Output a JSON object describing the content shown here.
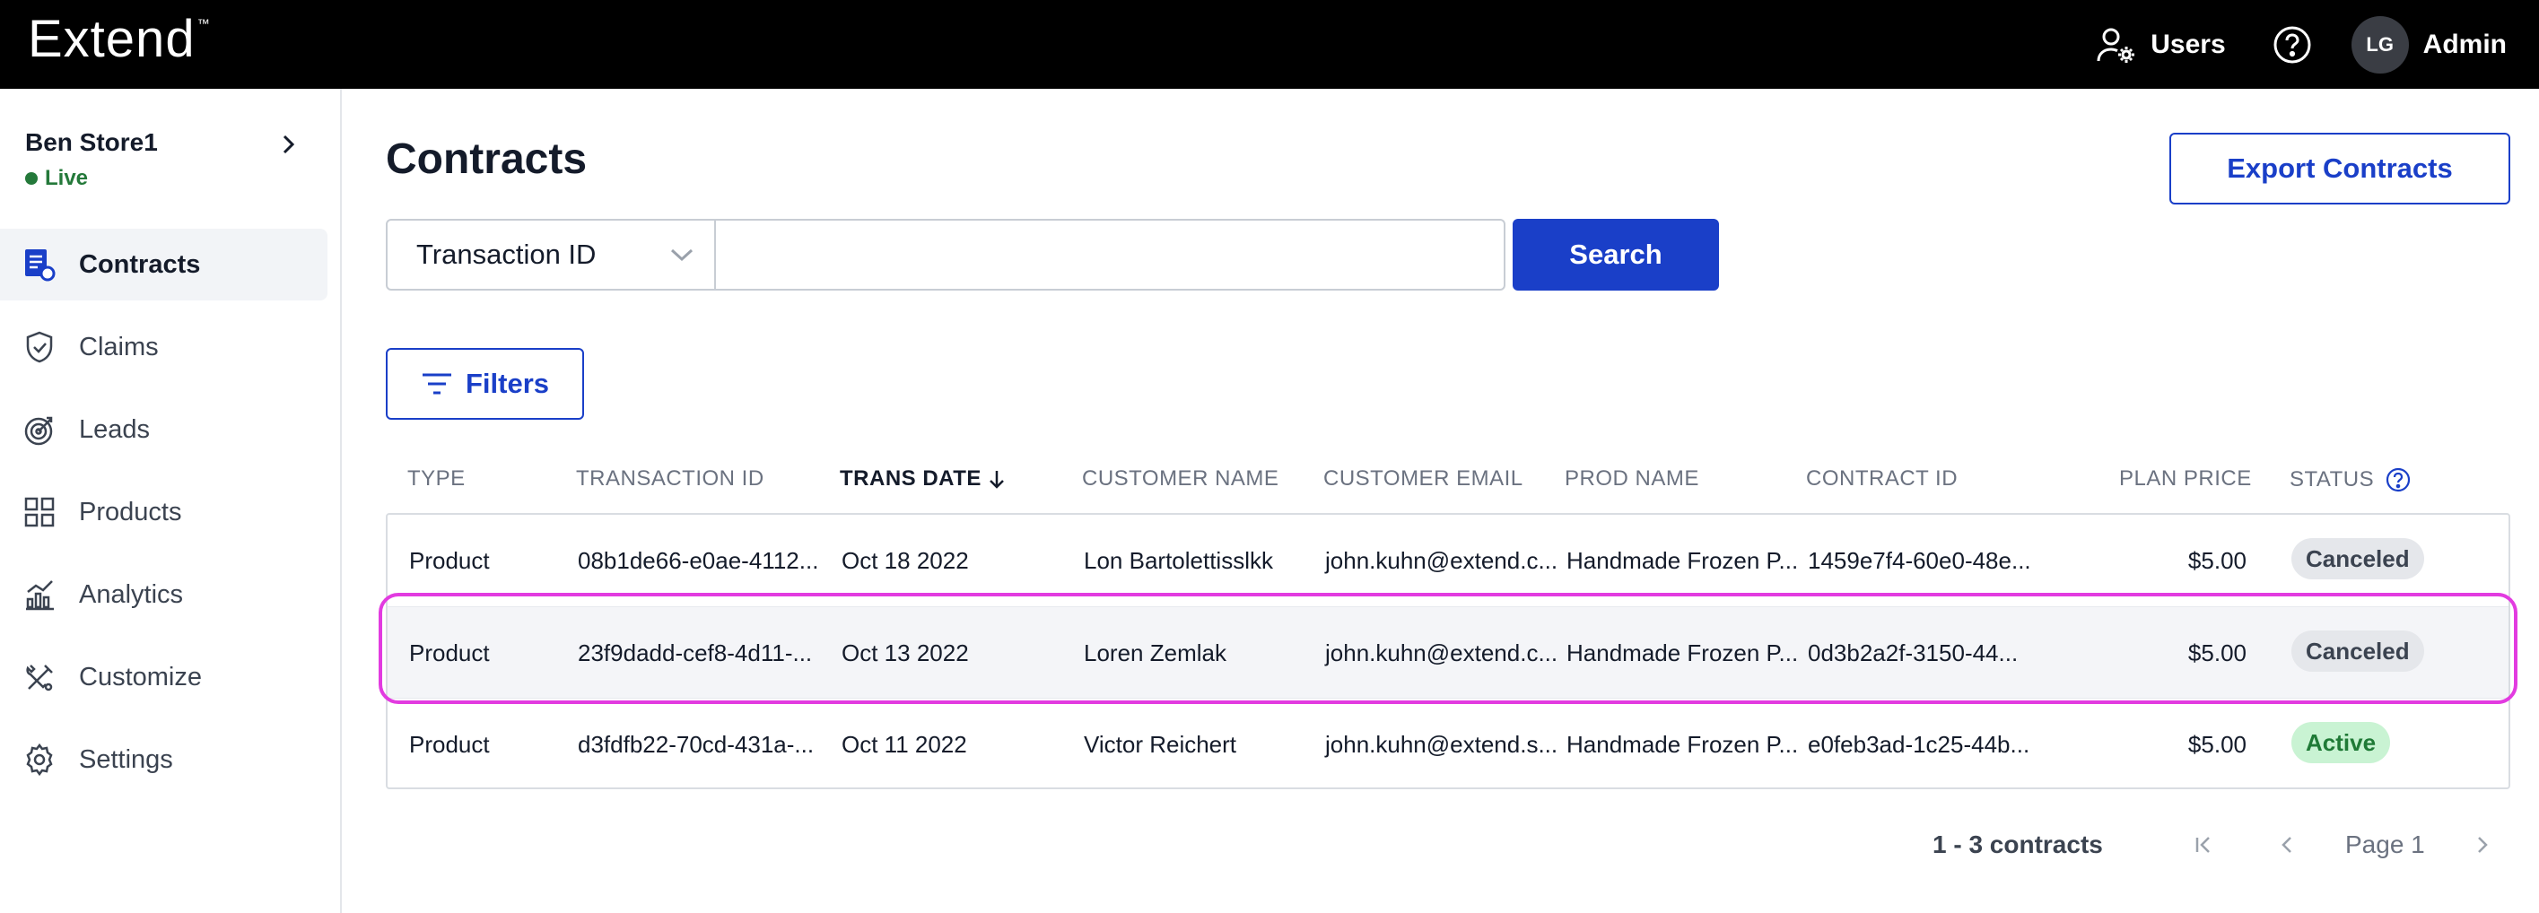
{
  "header": {
    "logo": "Extend",
    "logo_tm": "™",
    "users_label": "Users",
    "avatar_initials": "LG",
    "account_label": "Admin"
  },
  "store": {
    "name": "Ben Store1",
    "status": "Live"
  },
  "sidebar": {
    "items": [
      {
        "label": "Contracts",
        "icon": "contracts-icon",
        "active": true
      },
      {
        "label": "Claims",
        "icon": "shield-icon"
      },
      {
        "label": "Leads",
        "icon": "leads-icon"
      },
      {
        "label": "Products",
        "icon": "grid-icon"
      },
      {
        "label": "Analytics",
        "icon": "analytics-icon"
      },
      {
        "label": "Customize",
        "icon": "tools-icon"
      },
      {
        "label": "Settings",
        "icon": "gear-icon"
      }
    ]
  },
  "main": {
    "title": "Contracts",
    "export_label": "Export Contracts",
    "search": {
      "select_value": "Transaction ID",
      "input_value": "",
      "button_label": "Search"
    },
    "filters_label": "Filters"
  },
  "table": {
    "columns": [
      "TYPE",
      "TRANSACTION ID",
      "TRANS DATE",
      "CUSTOMER NAME",
      "CUSTOMER EMAIL",
      "PROD NAME",
      "CONTRACT ID",
      "PLAN PRICE",
      "STATUS"
    ],
    "sorted_column": "TRANS DATE",
    "rows": [
      {
        "type": "Product",
        "transaction_id": "08b1de66-e0ae-4112...",
        "trans_date": "Oct 18 2022",
        "customer_name": "Lon Bartolettisslkk",
        "customer_email": "john.kuhn@extend.c...",
        "prod_name": "Handmade Frozen P...",
        "contract_id": "1459e7f4-60e0-48e...",
        "plan_price": "$5.00",
        "status": "Canceled"
      },
      {
        "type": "Product",
        "transaction_id": "23f9dadd-cef8-4d11-...",
        "trans_date": "Oct 13 2022",
        "customer_name": "Loren Zemlak",
        "customer_email": "john.kuhn@extend.c...",
        "prod_name": "Handmade Frozen P...",
        "contract_id": "0d3b2a2f-3150-44...",
        "plan_price": "$5.00",
        "status": "Canceled"
      },
      {
        "type": "Product",
        "transaction_id": "d3fdfb22-70cd-431a-...",
        "trans_date": "Oct 11 2022",
        "customer_name": "Victor Reichert",
        "customer_email": "john.kuhn@extend.s...",
        "prod_name": "Handmade Frozen P...",
        "contract_id": "e0feb3ad-1c25-44b...",
        "plan_price": "$5.00",
        "status": "Active"
      }
    ]
  },
  "pagination": {
    "count_label": "1 - 3 contracts",
    "page_label": "Page 1"
  },
  "colors": {
    "brand_blue": "#1a3fc8",
    "live_green": "#24793a",
    "highlight": "#e23be0"
  }
}
